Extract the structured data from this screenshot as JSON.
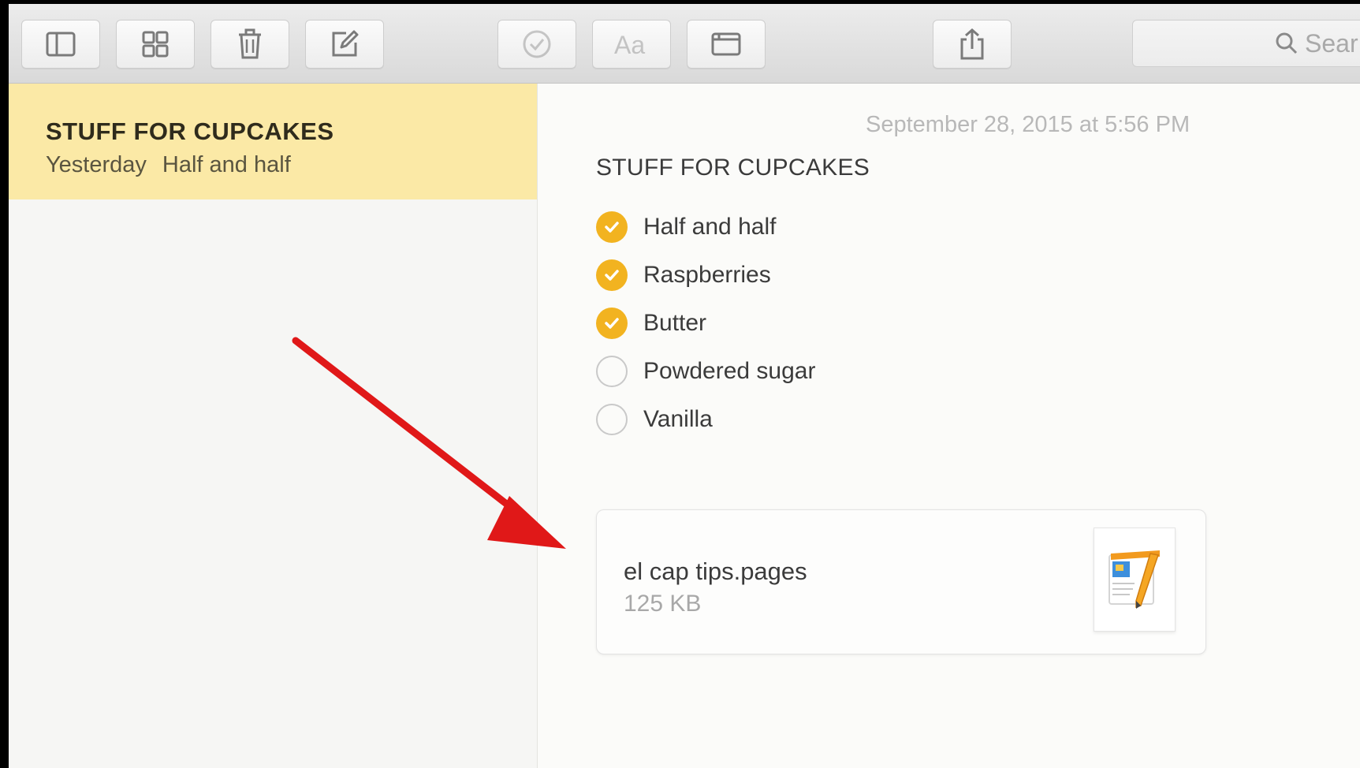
{
  "toolbar": {
    "search_placeholder": "Sear",
    "buttons": [
      {
        "icon": "sidebar-toggle-icon"
      },
      {
        "icon": "attachments-grid-icon"
      },
      {
        "icon": "trash-icon"
      },
      {
        "icon": "compose-icon"
      },
      {
        "icon": "checklist-icon"
      },
      {
        "icon": "font-format-icon"
      },
      {
        "icon": "table-icon"
      },
      {
        "icon": "share-icon"
      }
    ]
  },
  "sidebar": {
    "selected_note": {
      "title": "STUFF FOR CUPCAKES",
      "date": "Yesterday",
      "preview": "Half and half"
    }
  },
  "note": {
    "date": "September 28, 2015 at 5:56 PM",
    "heading": "STUFF FOR CUPCAKES",
    "checklist": [
      {
        "label": "Half and half",
        "checked": true
      },
      {
        "label": "Raspberries",
        "checked": true
      },
      {
        "label": "Butter",
        "checked": true
      },
      {
        "label": "Powdered sugar",
        "checked": false
      },
      {
        "label": "Vanilla",
        "checked": false
      }
    ],
    "attachment": {
      "name": "el cap tips.pages",
      "size": "125 KB",
      "icon": "pages-document-icon"
    }
  },
  "colors": {
    "selection": "#fbe9a6",
    "check_accent": "#f2b320",
    "annotation_arrow": "#e01818"
  }
}
